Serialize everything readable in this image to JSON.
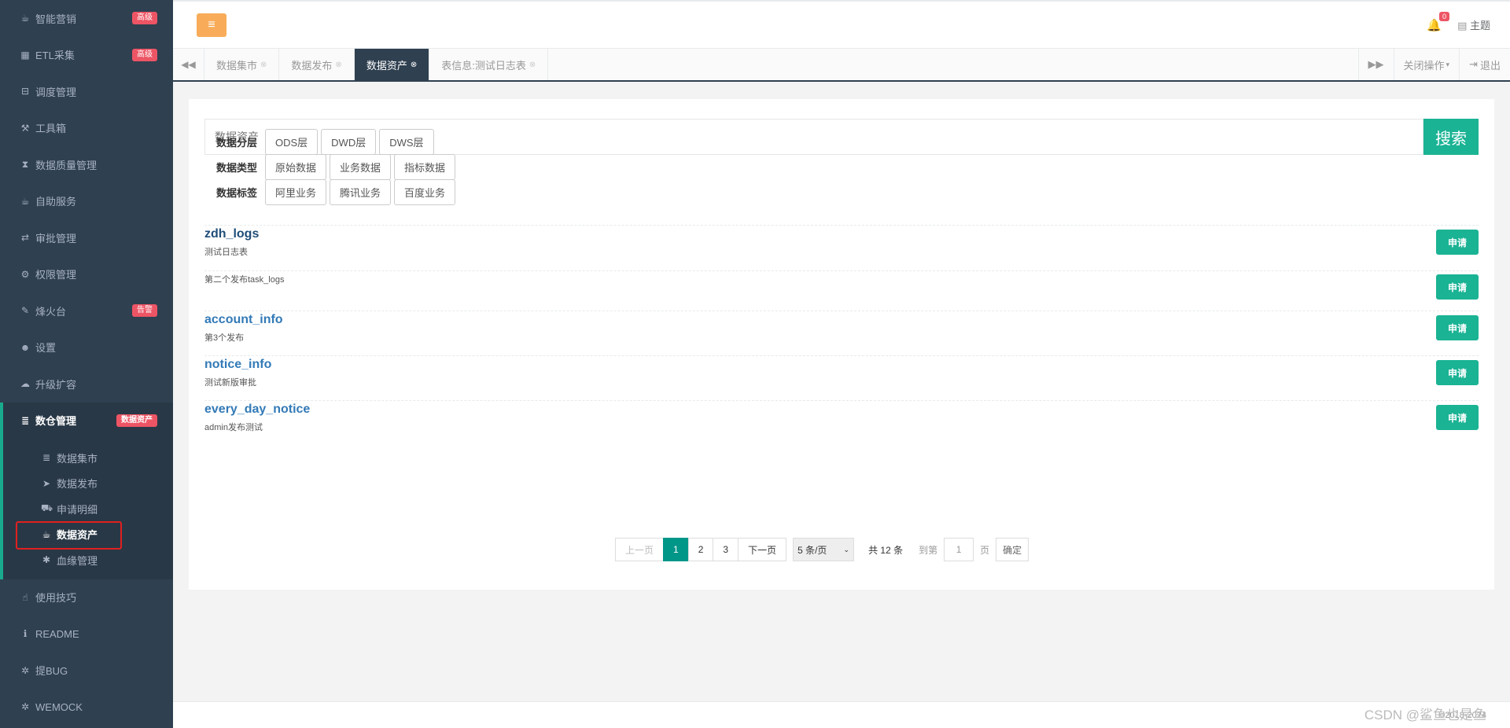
{
  "sidebar": {
    "items": [
      {
        "label": "智能营销",
        "icon": "cup-icon",
        "glyph": "☕",
        "badge": "高级"
      },
      {
        "label": "ETL采集",
        "icon": "table-icon",
        "glyph": "▦",
        "badge": "高级"
      },
      {
        "label": "调度管理",
        "icon": "bus-icon",
        "glyph": "⊟",
        "badge": ""
      },
      {
        "label": "工具箱",
        "icon": "gavel-icon",
        "glyph": "⚒",
        "badge": ""
      },
      {
        "label": "数据质量管理",
        "icon": "hourglass-icon",
        "glyph": "⧗",
        "badge": ""
      },
      {
        "label": "自助服务",
        "icon": "coffee-icon",
        "glyph": "☕",
        "badge": ""
      },
      {
        "label": "审批管理",
        "icon": "exchange-icon",
        "glyph": "⇄",
        "badge": ""
      },
      {
        "label": "权限管理",
        "icon": "gear-icon",
        "glyph": "⚙",
        "badge": ""
      },
      {
        "label": "烽火台",
        "icon": "pen-icon",
        "glyph": "✎",
        "badge": "告警"
      },
      {
        "label": "设置",
        "icon": "user-icon",
        "glyph": "☻",
        "badge": ""
      },
      {
        "label": "升级扩容",
        "icon": "cloud-icon",
        "glyph": "☁",
        "badge": ""
      }
    ],
    "active": {
      "label": "数仓管理",
      "icon": "database-icon",
      "glyph": "≣",
      "badge": "数据资产"
    },
    "sub_items": [
      {
        "label": "数据集市",
        "icon": "database-icon",
        "glyph": "≣"
      },
      {
        "label": "数据发布",
        "icon": "send-icon",
        "glyph": "➤"
      },
      {
        "label": "申请明细",
        "icon": "truck-icon",
        "glyph": "⛟"
      },
      {
        "label": "数据资产",
        "icon": "coffee-icon",
        "glyph": "☕"
      },
      {
        "label": "血缘管理",
        "icon": "asterisk-icon",
        "glyph": "✱"
      }
    ],
    "bottom_items": [
      {
        "label": "使用技巧",
        "icon": "thumbs-up-icon",
        "glyph": "☝"
      },
      {
        "label": "README",
        "icon": "info-icon",
        "glyph": "ℹ"
      },
      {
        "label": "提BUG",
        "icon": "bug-icon",
        "glyph": "✲"
      },
      {
        "label": "WEMOCK",
        "icon": "bug-icon",
        "glyph": "✲"
      }
    ]
  },
  "topbar": {
    "notification_count": "0",
    "theme_label": "主题"
  },
  "tabs": {
    "items": [
      {
        "label": "数据集市",
        "active": false
      },
      {
        "label": "数据发布",
        "active": false
      },
      {
        "label": "数据资产",
        "active": true
      },
      {
        "label": "表信息:测试日志表",
        "active": false
      }
    ],
    "close_ops": "关闭操作",
    "logout": "退出"
  },
  "search": {
    "placeholder": "数据资产",
    "button": "搜索"
  },
  "filters": [
    {
      "label": "数据分层",
      "options": [
        "ODS层",
        "DWD层",
        "DWS层"
      ]
    },
    {
      "label": "数据类型",
      "options": [
        "原始数据",
        "业务数据",
        "指标数据"
      ]
    },
    {
      "label": "数据标签",
      "options": [
        "阿里业务",
        "腾讯业务",
        "百度业务"
      ]
    }
  ],
  "assets": [
    {
      "name": "zdh_logs",
      "desc": "测试日志表",
      "action": "申请"
    },
    {
      "name": "",
      "desc": "第二个发布task_logs",
      "action": "申请"
    },
    {
      "name": "account_info",
      "desc": "第3个发布",
      "action": "申请"
    },
    {
      "name": "notice_info",
      "desc": "测试新版审批",
      "action": "申请"
    },
    {
      "name": "every_day_notice",
      "desc": "admin发布测试",
      "action": "申请"
    }
  ],
  "pager": {
    "prev": "上一页",
    "pages": [
      "1",
      "2",
      "3"
    ],
    "current": "1",
    "next": "下一页",
    "page_size": "5 条/页",
    "total": "共 12 条",
    "goto_label": "到第",
    "goto_value": "1",
    "page_unit": "页",
    "confirm": "确定"
  },
  "footer": {
    "copyright": "©2018-2024",
    "watermark": "CSDN @鲨鱼也是鱼"
  }
}
